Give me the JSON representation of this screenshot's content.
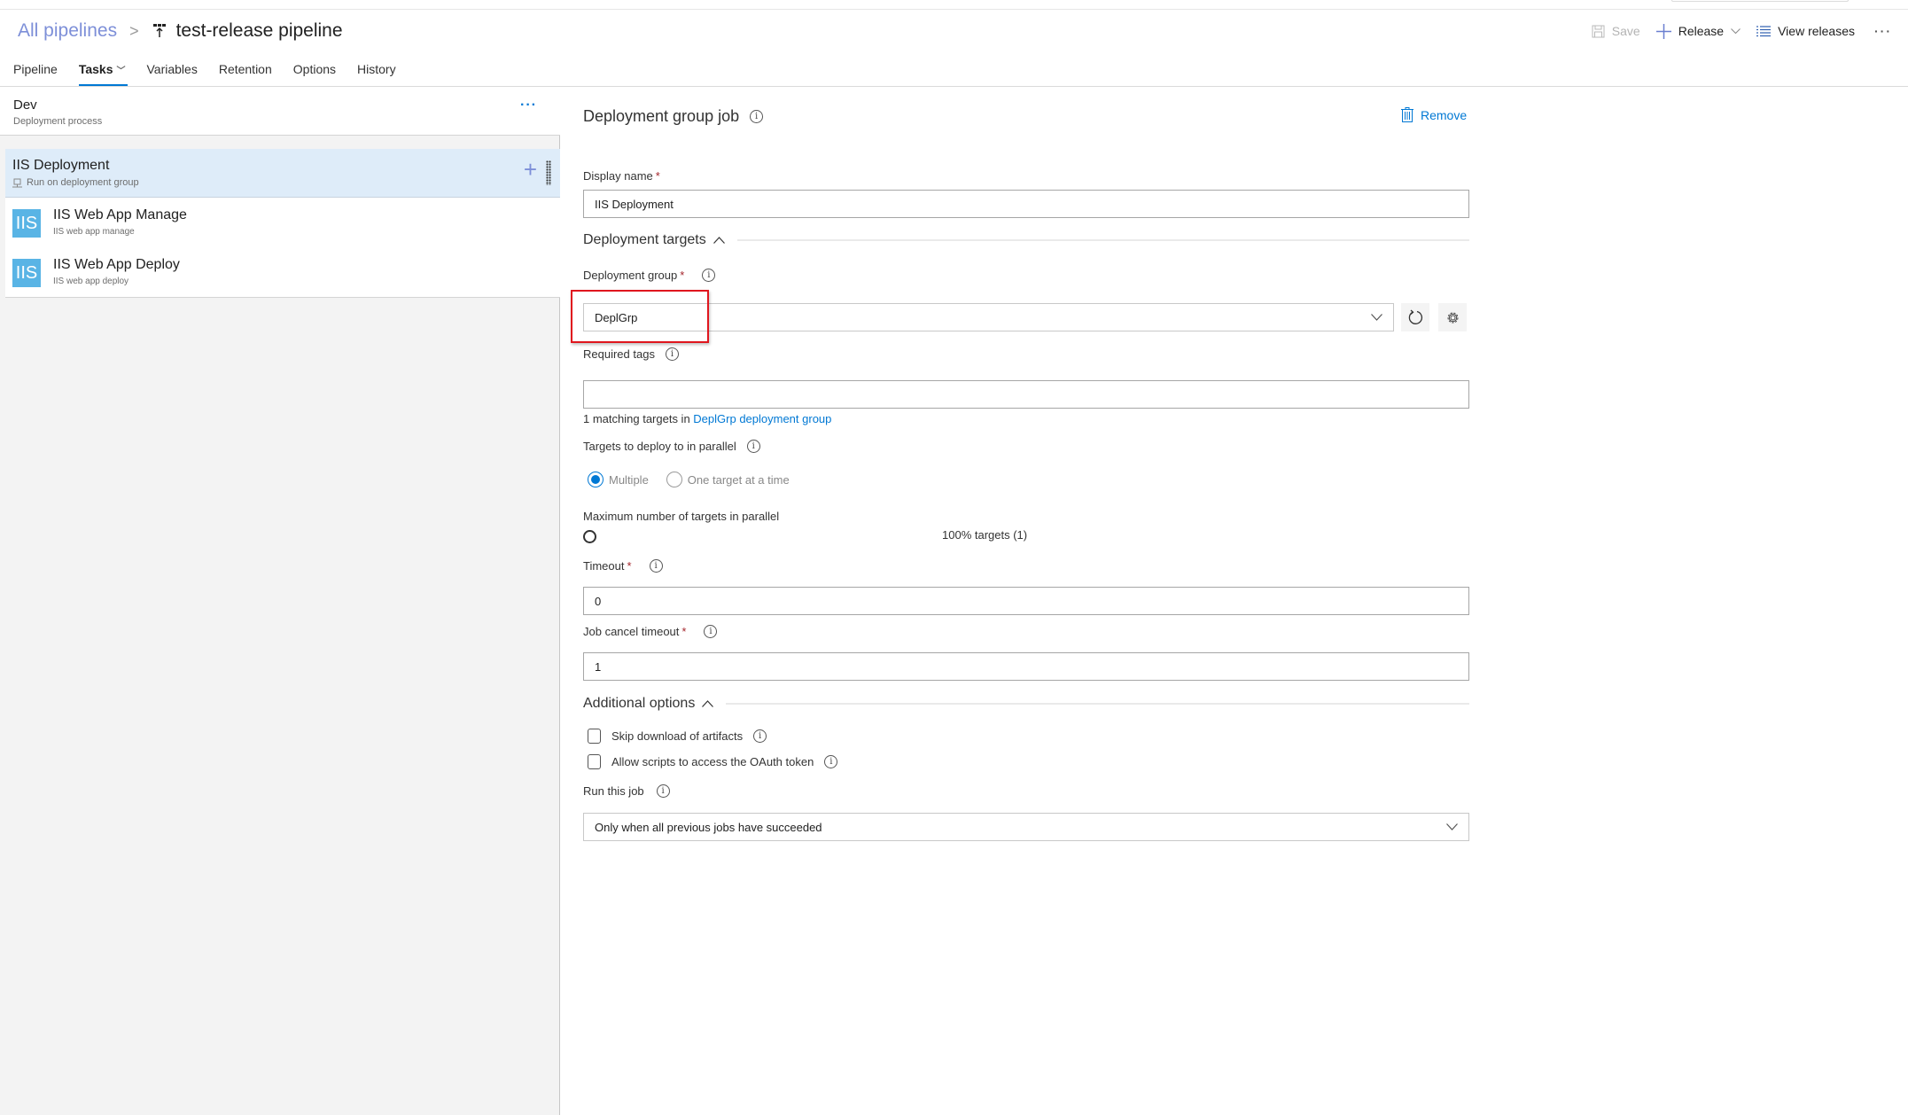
{
  "header": {
    "breadcrumb_root": "All pipelines",
    "breadcrumb_separator": ">",
    "pipeline_icon": "release-pipeline-icon",
    "title": "test-release pipeline"
  },
  "toolbar": {
    "save_label": "Save",
    "release_label": "Release",
    "view_releases_label": "View releases",
    "more_label": "···"
  },
  "tabs": [
    {
      "label": "Pipeline",
      "active": false
    },
    {
      "label": "Tasks",
      "active": true,
      "has_dropdown": true
    },
    {
      "label": "Variables",
      "active": false
    },
    {
      "label": "Retention",
      "active": false
    },
    {
      "label": "Options",
      "active": false
    },
    {
      "label": "History",
      "active": false
    }
  ],
  "left_panel": {
    "stage_name": "Dev",
    "stage_subtitle": "Deployment process",
    "stage_more": "···",
    "job": {
      "name": "IIS Deployment",
      "subtitle": "Run on deployment group",
      "add_label": "+"
    },
    "tasks": [
      {
        "icon_text": "IIS",
        "name": "IIS Web App Manage",
        "subtitle": "IIS web app manage"
      },
      {
        "icon_text": "IIS",
        "name": "IIS Web App Deploy",
        "subtitle": "IIS web app deploy"
      }
    ]
  },
  "details": {
    "title": "Deployment group job",
    "remove_label": "Remove",
    "display_name": {
      "label": "Display name",
      "required": "*",
      "value": "IIS Deployment"
    },
    "deployment_targets_section": "Deployment targets",
    "deployment_group": {
      "label": "Deployment group",
      "required": "*",
      "value": "DeplGrp"
    },
    "required_tags": {
      "label": "Required tags",
      "value": ""
    },
    "matching_text": "1 matching targets in ",
    "matching_link": "DeplGrp deployment group",
    "parallel": {
      "label": "Targets to deploy to in parallel",
      "options": [
        "Multiple",
        "One target at a time"
      ],
      "selected": "Multiple"
    },
    "max_targets": {
      "label": "Maximum number of targets in parallel",
      "value_text": "100% targets (1)",
      "slider_percent": 100
    },
    "timeout": {
      "label": "Timeout",
      "required": "*",
      "value": "0"
    },
    "job_cancel_timeout": {
      "label": "Job cancel timeout",
      "required": "*",
      "value": "1"
    },
    "additional_options_section": "Additional options",
    "skip_download": {
      "label": "Skip download of artifacts",
      "checked": false
    },
    "allow_oauth": {
      "label": "Allow scripts to access the OAuth token",
      "checked": false
    },
    "run_this_job": {
      "label": "Run this job",
      "value": "Only when all previous jobs have succeeded"
    }
  },
  "colors": {
    "accent": "#0078d4",
    "selected_row": "#deecf9",
    "iis_icon": "#59b4e5",
    "highlight": "#e0161e",
    "required": "#a4262c"
  }
}
